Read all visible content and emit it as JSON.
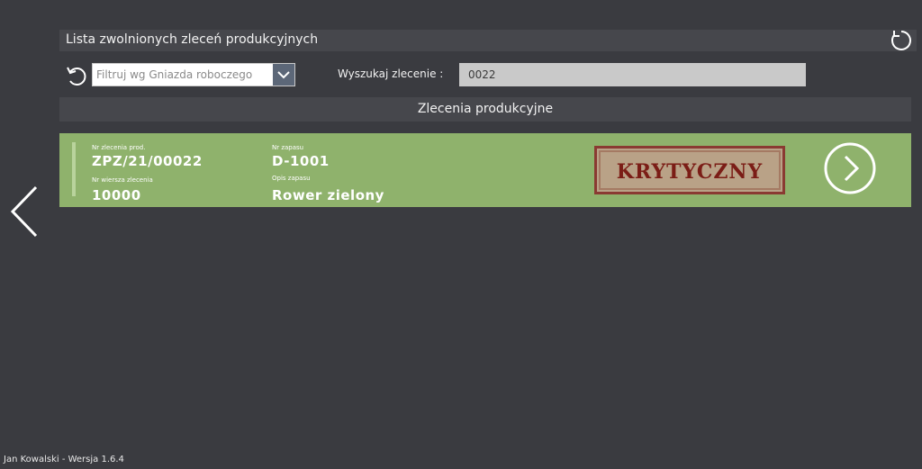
{
  "header": {
    "title": "Lista zwolnionych zleceń produkcyjnych",
    "refresh_icon": "refresh-icon"
  },
  "filter": {
    "placeholder": "Filtruj wg Gniazda roboczego",
    "value": ""
  },
  "search": {
    "label": "Wyszukaj zlecenie :",
    "value": "0022"
  },
  "section": {
    "title": "Zlecenia produkcyjne"
  },
  "orders": [
    {
      "order_no_label": "Nr zlecenia prod.",
      "order_no": "ZPZ/21/00022",
      "line_no_label": "Nr wiersza zlecenia",
      "line_no": "10000",
      "item_no_label": "Nr zapasu",
      "item_no": "D-1001",
      "item_desc_label": "Opis zapasu",
      "item_desc": "Rower zielony",
      "priority": "KRYTYCZNY"
    }
  ],
  "footer": {
    "text": "Jan Kowalski - Wersja 1.6.4"
  },
  "colors": {
    "background": "#3a3b40",
    "card": "#8fb26c",
    "stamp_text": "#7b1d16",
    "dropdown": "#5c6778"
  }
}
